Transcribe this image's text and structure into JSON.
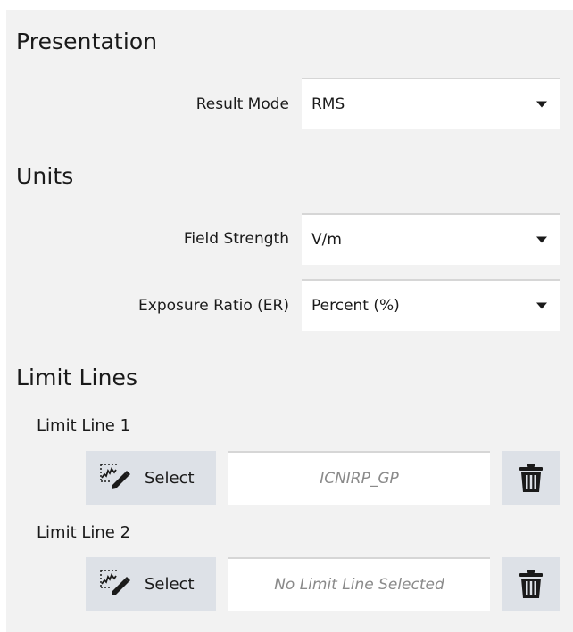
{
  "presentation": {
    "heading": "Presentation",
    "result_mode": {
      "label": "Result Mode",
      "value": "RMS"
    }
  },
  "units": {
    "heading": "Units",
    "field_strength": {
      "label": "Field Strength",
      "value": "V/m"
    },
    "exposure_ratio": {
      "label": "Exposure Ratio (ER)",
      "value": "Percent (%)"
    }
  },
  "limit_lines": {
    "heading": "Limit Lines",
    "items": [
      {
        "label": "Limit Line 1",
        "select_label": "Select",
        "value": "ICNIRP_GP",
        "select_icon": "select-limit-line-icon",
        "delete_icon": "trash-icon"
      },
      {
        "label": "Limit Line 2",
        "select_label": "Select",
        "value": "No Limit Line Selected",
        "select_icon": "select-limit-line-icon",
        "delete_icon": "trash-icon"
      }
    ]
  }
}
